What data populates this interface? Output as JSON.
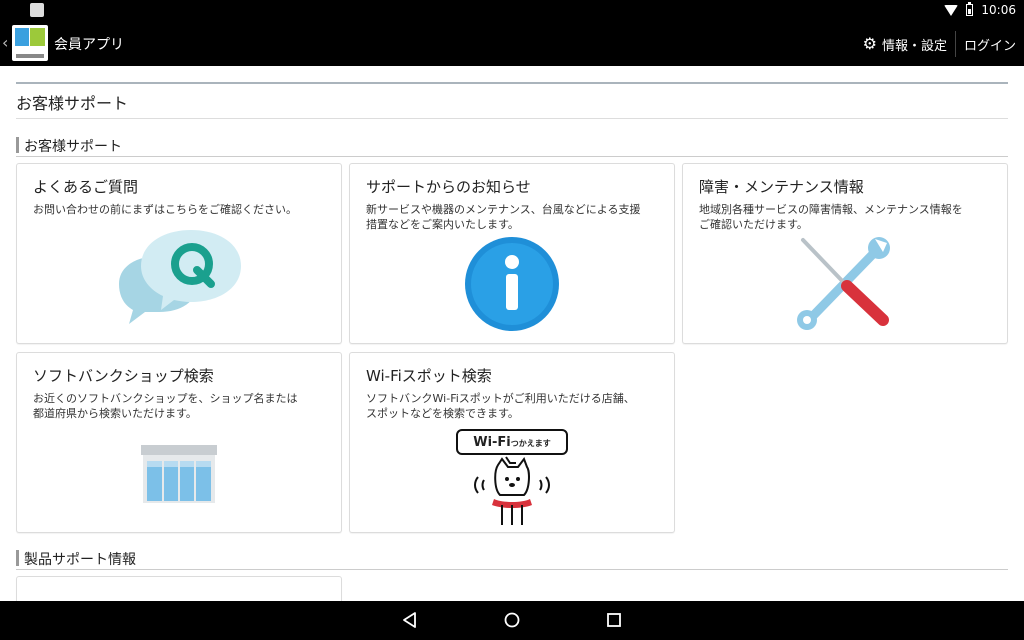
{
  "status_bar": {
    "time": "10:06"
  },
  "app_bar": {
    "title": "会員アプリ",
    "settings_label": "情報・設定",
    "login_label": "ログイン"
  },
  "page": {
    "title": "お客様サポート"
  },
  "sections": {
    "support": {
      "label": "お客様サポート",
      "cards": [
        {
          "title": "よくあるご質問",
          "desc": [
            "お問い合わせの前にまずはこちらをご確認ください。"
          ],
          "icon": "faq-q-bubble-icon"
        },
        {
          "title": "サポートからのお知らせ",
          "desc": [
            "新サービスや機器のメンテナンス、台風などによる支援",
            "措置などをご案内いたします。"
          ],
          "icon": "info-icon"
        },
        {
          "title": "障害・メンテナンス情報",
          "desc": [
            "地域別各種サービスの障害情報、メンテナンス情報を",
            "ご確認いただけます。"
          ],
          "icon": "tools-icon"
        },
        {
          "title": "ソフトバンクショップ検索",
          "desc": [
            "お近くのソフトバンクショップを、ショップ名または",
            "都道府県から検索いただけます。"
          ],
          "icon": "shop-icon"
        },
        {
          "title": "Wi-Fiスポット検索",
          "desc": [
            "ソフトバンクWi-Fiスポットがご利用いただける店舗、",
            "スポットなどを検索できます。"
          ],
          "icon": "wifi-dog-icon",
          "badge_main": "Wi-Fi",
          "badge_sub": "つかえます"
        }
      ]
    },
    "product": {
      "label": "製品サポート情報"
    }
  },
  "colors": {
    "bubble_front": "#a6d5e4",
    "bubble_back": "#d2ecf3",
    "q_green": "#1aa08e",
    "info_blue": "#1f8fd8",
    "wrench": "#8fc9e6",
    "screwdriver": "#d8323c",
    "shop_glass": "#7cc0e8"
  }
}
